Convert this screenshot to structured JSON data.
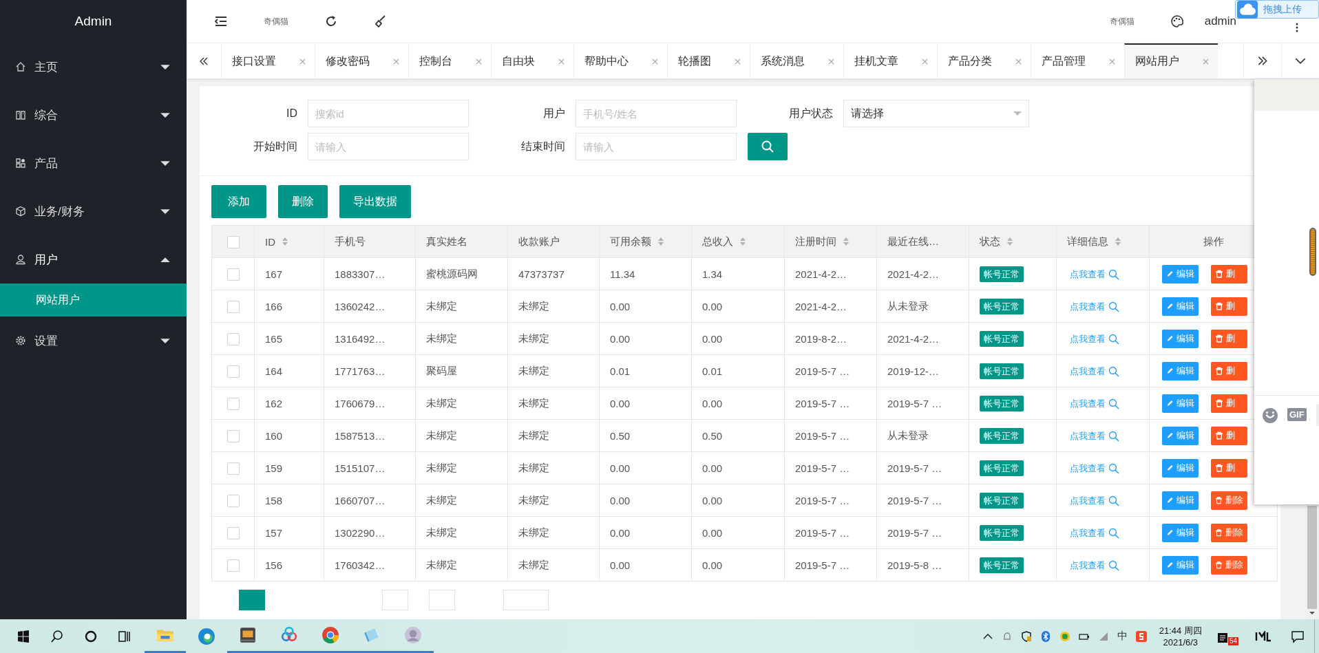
{
  "sidebar": {
    "title": "Admin",
    "items": [
      {
        "label": "主页",
        "expanded": false
      },
      {
        "label": "综合",
        "expanded": false
      },
      {
        "label": "产品",
        "expanded": false
      },
      {
        "label": "业务/财务",
        "expanded": false
      },
      {
        "label": "用户",
        "expanded": true,
        "children": [
          {
            "label": "网站用户",
            "selected": true
          }
        ]
      },
      {
        "label": "设置",
        "expanded": false
      }
    ]
  },
  "header": {
    "left_text": "奇偶猫",
    "right_text": "奇偶猫",
    "user": "admin",
    "upload_button": "拖拽上传"
  },
  "tabs": [
    {
      "label": "接口设置",
      "selected": false
    },
    {
      "label": "修改密码",
      "selected": false
    },
    {
      "label": "控制台",
      "selected": false
    },
    {
      "label": "自由块",
      "selected": false
    },
    {
      "label": "帮助中心",
      "selected": false
    },
    {
      "label": "轮播图",
      "selected": false
    },
    {
      "label": "系统消息",
      "selected": false
    },
    {
      "label": "挂机文章",
      "selected": false
    },
    {
      "label": "产品分类",
      "selected": false
    },
    {
      "label": "产品管理",
      "selected": false
    },
    {
      "label": "网站用户",
      "selected": true
    }
  ],
  "filters": [
    {
      "label": "ID",
      "kind": "input",
      "placeholder": "搜索id"
    },
    {
      "label": "用户",
      "kind": "input",
      "placeholder": "手机号/姓名"
    },
    {
      "label": "用户状态",
      "kind": "select",
      "value": "请选择"
    },
    {
      "label": "开始时间",
      "kind": "input",
      "placeholder": "请输入"
    },
    {
      "label": "结束时间",
      "kind": "input",
      "placeholder": "请输入"
    }
  ],
  "actions": [
    "添加",
    "删除",
    "导出数据"
  ],
  "table": {
    "select_all_checked": false,
    "columns": [
      {
        "label": "ID",
        "sortable": true
      },
      {
        "label": "手机号",
        "sortable": false
      },
      {
        "label": "真实姓名",
        "sortable": false
      },
      {
        "label": "收款账户",
        "sortable": false
      },
      {
        "label": "可用余额",
        "sortable": true
      },
      {
        "label": "总收入",
        "sortable": true
      },
      {
        "label": "注册时间",
        "sortable": true
      },
      {
        "label": "最近在线…",
        "sortable": false
      },
      {
        "label": "状态",
        "sortable": true
      },
      {
        "label": "详细信息",
        "sortable": true
      },
      {
        "label": "操作",
        "sortable": false
      }
    ],
    "rows": [
      {
        "checked": false,
        "cells": [
          "167",
          "1883307…",
          "蜜桃源码网",
          "47373737",
          "11.34",
          "1.34",
          "2021-4-2…",
          "2021-4-2…"
        ],
        "status": "帐号正常",
        "detail": "点我查看",
        "edit": "编辑",
        "delete": "删"
      },
      {
        "checked": false,
        "cells": [
          "166",
          "1360242…",
          "未绑定",
          "未绑定",
          "0.00",
          "0.00",
          "2021-4-2…",
          "从未登录"
        ],
        "status": "帐号正常",
        "detail": "点我查看",
        "edit": "编辑",
        "delete": "删"
      },
      {
        "checked": false,
        "cells": [
          "165",
          "1316492…",
          "未绑定",
          "未绑定",
          "0.00",
          "0.00",
          "2019-8-2…",
          "2021-4-2…"
        ],
        "status": "帐号正常",
        "detail": "点我查看",
        "edit": "编辑",
        "delete": "删"
      },
      {
        "checked": false,
        "cells": [
          "164",
          "1771763…",
          "聚码屋",
          "未绑定",
          "0.01",
          "0.01",
          "2019-5-7 …",
          "2019-12-…"
        ],
        "status": "帐号正常",
        "detail": "点我查看",
        "edit": "编辑",
        "delete": "删"
      },
      {
        "checked": false,
        "cells": [
          "162",
          "1760679…",
          "未绑定",
          "未绑定",
          "0.00",
          "0.00",
          "2019-5-7 …",
          "2019-5-7 …"
        ],
        "status": "帐号正常",
        "detail": "点我查看",
        "edit": "编辑",
        "delete": "删"
      },
      {
        "checked": false,
        "cells": [
          "160",
          "1587513…",
          "未绑定",
          "未绑定",
          "0.50",
          "0.50",
          "2019-5-7 …",
          "从未登录"
        ],
        "status": "帐号正常",
        "detail": "点我查看",
        "edit": "编辑",
        "delete": "删"
      },
      {
        "checked": false,
        "cells": [
          "159",
          "1515107…",
          "未绑定",
          "未绑定",
          "0.00",
          "0.00",
          "2019-5-7 …",
          "2019-5-7 …"
        ],
        "status": "帐号正常",
        "detail": "点我查看",
        "edit": "编辑",
        "delete": "删"
      },
      {
        "checked": false,
        "cells": [
          "158",
          "1660707…",
          "未绑定",
          "未绑定",
          "0.00",
          "0.00",
          "2019-5-7 …",
          "2019-5-7 …"
        ],
        "status": "帐号正常",
        "detail": "点我查看",
        "edit": "编辑",
        "delete": "删除"
      },
      {
        "checked": false,
        "cells": [
          "157",
          "1302290…",
          "未绑定",
          "未绑定",
          "0.00",
          "0.00",
          "2019-5-7 …",
          "2019-5-7 …"
        ],
        "status": "帐号正常",
        "detail": "点我查看",
        "edit": "编辑",
        "delete": "删除"
      },
      {
        "checked": false,
        "cells": [
          "156",
          "1760342…",
          "未绑定",
          "未绑定",
          "0.00",
          "0.00",
          "2019-5-7 …",
          "2019-5-8 …"
        ],
        "status": "帐号正常",
        "detail": "点我查看",
        "edit": "编辑",
        "delete": "删除"
      }
    ]
  },
  "side_panel": {
    "gif_label": "GIF"
  },
  "taskbar": {
    "ime": "中",
    "time": "21:44 周四",
    "date": "2021/6/3",
    "notification_count": "54"
  }
}
